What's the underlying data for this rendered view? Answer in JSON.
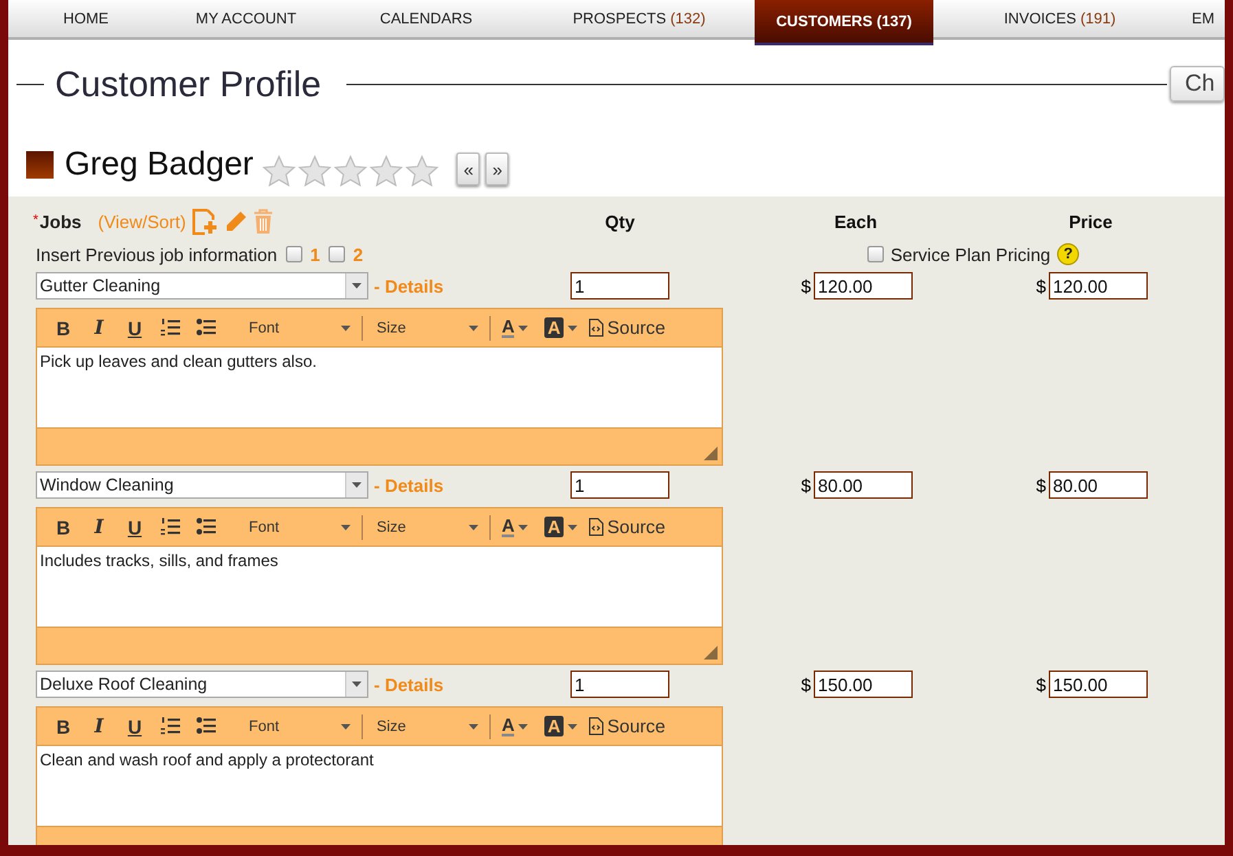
{
  "nav": {
    "tabs": [
      {
        "label": "HOME",
        "selected": false
      },
      {
        "label": "MY ACCOUNT",
        "selected": false
      },
      {
        "label": "CALENDARS",
        "selected": false
      },
      {
        "label": "PROSPECTS",
        "count": "(132)",
        "selected": false
      },
      {
        "label": "CUSTOMERS",
        "count": "(137)",
        "selected": true
      },
      {
        "label": "INVOICES",
        "count": "(191)",
        "selected": false
      },
      {
        "label": "EM",
        "selected": false
      }
    ]
  },
  "page_title": "Customer Profile",
  "side_button": "Ch",
  "customer": {
    "name": "Greg Badger",
    "stars": 0,
    "prev_button": "«",
    "next_button": "»"
  },
  "jobs": {
    "required_mark": "*",
    "label": "Jobs",
    "view_sort": "(View/Sort)",
    "columns": [
      "Qty",
      "Each",
      "Price"
    ],
    "insert_previous": {
      "label": "Insert Previous job information",
      "options": [
        {
          "label": "1",
          "checked": false
        },
        {
          "label": "2",
          "checked": false
        }
      ]
    },
    "service_plan": {
      "label": "Service Plan Pricing",
      "checked": false,
      "help": "?"
    },
    "items": [
      {
        "service": "Gutter Cleaning",
        "details": "- Details",
        "qty": "1",
        "each_currency": "$",
        "each": "120.00",
        "price_currency": "$",
        "price": "120.00",
        "toolbar": {
          "bold": "B",
          "italic": "I",
          "underline": "U",
          "font": "Font",
          "size": "Size",
          "text_color": "A",
          "background_color": "A",
          "source": "Source"
        },
        "description": "Pick up leaves and clean gutters also."
      },
      {
        "service": "Window Cleaning",
        "details": "- Details",
        "qty": "1",
        "each_currency": "$",
        "each": "80.00",
        "price_currency": "$",
        "price": "80.00",
        "toolbar": {
          "bold": "B",
          "italic": "I",
          "underline": "U",
          "font": "Font",
          "size": "Size",
          "text_color": "A",
          "background_color": "A",
          "source": "Source"
        },
        "description": "Includes tracks, sills, and frames"
      },
      {
        "service": "Deluxe Roof Cleaning",
        "details": "- Details",
        "qty": "1",
        "each_currency": "$",
        "each": "150.00",
        "price_currency": "$",
        "price": "150.00",
        "toolbar": {
          "bold": "B",
          "italic": "I",
          "underline": "U",
          "font": "Font",
          "size": "Size",
          "text_color": "A",
          "background_color": "A",
          "source": "Source"
        },
        "description": "Clean and wash roof and apply a protectorant"
      }
    ]
  }
}
